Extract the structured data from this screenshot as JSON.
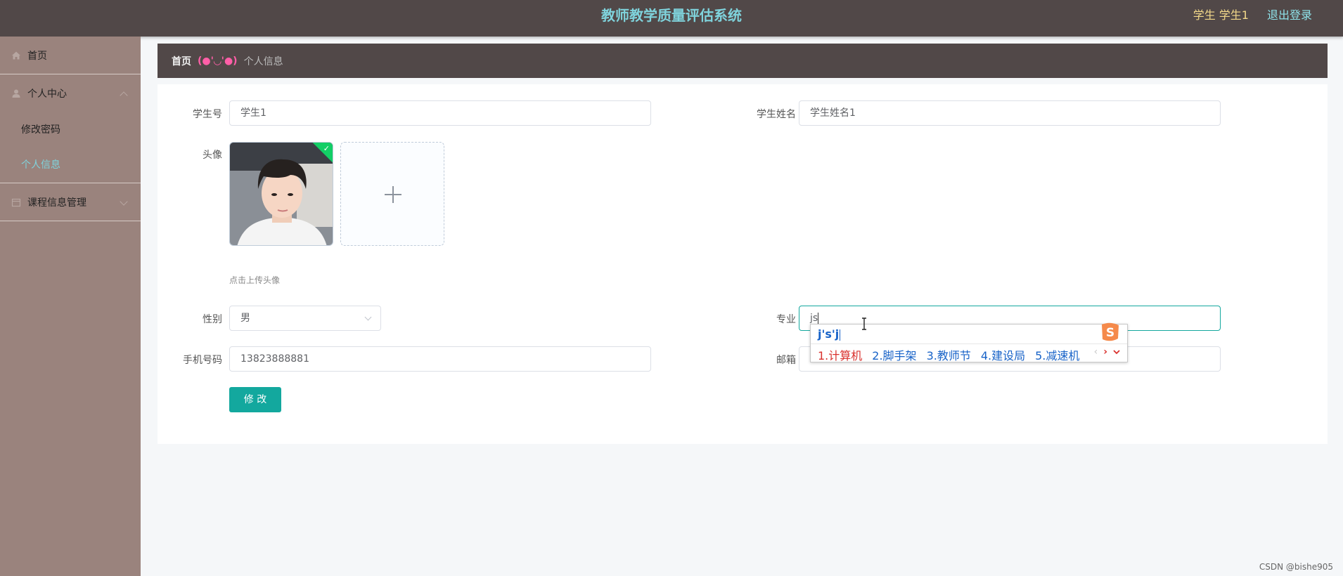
{
  "header": {
    "title": "教师教学质量评估系统",
    "user": "学生 学生1",
    "logout": "退出登录"
  },
  "sidebar": {
    "home": "首页",
    "personal_center": "个人中心",
    "change_password": "修改密码",
    "personal_info": "个人信息",
    "course_management": "课程信息管理"
  },
  "breadcrumb": {
    "home": "首页",
    "separator": "(●'◡'●)",
    "current": "个人信息"
  },
  "form": {
    "student_no_label": "学生号",
    "student_no_value": "学生1",
    "student_name_label": "学生姓名",
    "student_name_value": "学生姓名1",
    "avatar_label": "头像",
    "upload_tip": "点击上传头像",
    "gender_label": "性别",
    "gender_value": "男",
    "major_label": "专业",
    "major_value": "js",
    "phone_label": "手机号码",
    "phone_value": "13823888881",
    "email_label": "邮箱",
    "submit_label": "修 改"
  },
  "ime": {
    "composition": "j's'j",
    "candidates": [
      "1.计算机",
      "2.脚手架",
      "3.教师节",
      "4.建设局",
      "5.减速机"
    ]
  },
  "watermark": "CSDN @bishe905",
  "colors": {
    "header_bg": "#514848",
    "sidebar_bg": "#9a837d",
    "accent": "#13a89e",
    "title": "#7fd3dc"
  }
}
